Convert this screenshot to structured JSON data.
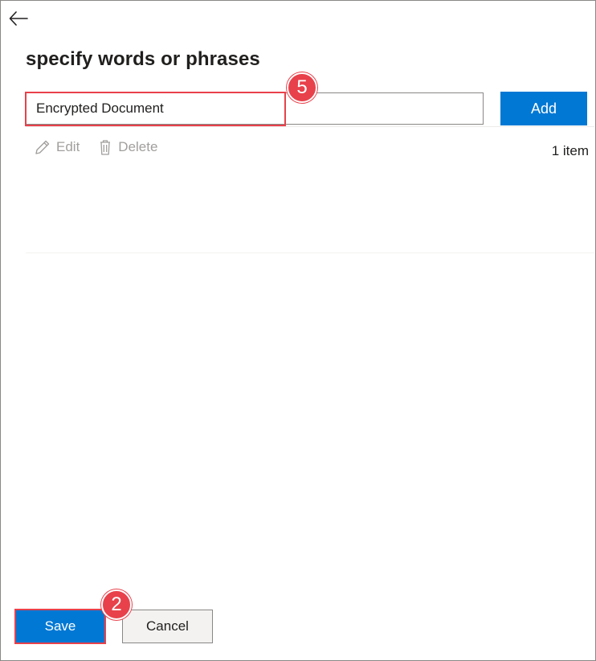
{
  "panel": {
    "title": "specify words or phrases",
    "back_icon": "back-arrow-icon"
  },
  "input": {
    "value": "Encrypted Document",
    "add_label": "Add"
  },
  "toolbar": {
    "edit_label": "Edit",
    "delete_label": "Delete",
    "edit_icon": "pencil-icon",
    "delete_icon": "trash-icon",
    "item_count": "1 item"
  },
  "footer": {
    "save_label": "Save",
    "cancel_label": "Cancel"
  },
  "annotations": {
    "badge_input": "5",
    "badge_save": "2",
    "highlight_color": "#e8414b"
  },
  "colors": {
    "accent": "#0078d4",
    "disabled_text": "#a19f9d"
  }
}
